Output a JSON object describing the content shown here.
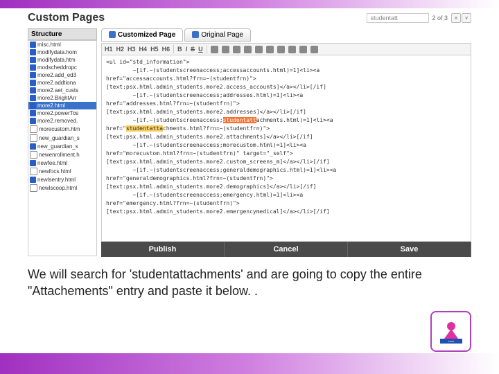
{
  "header": {
    "title": "Custom Pages",
    "search_value": "studentatt",
    "search_count": "2 of 3"
  },
  "sidebar": {
    "heading": "Structure",
    "items": [
      {
        "icon": "blue",
        "label": "misc.html"
      },
      {
        "icon": "blue",
        "label": "modifydata.hom"
      },
      {
        "icon": "blue",
        "label": "modifydata.htm"
      },
      {
        "icon": "blue",
        "label": "modscheddropc"
      },
      {
        "icon": "blue",
        "label": "more2.add_ed3"
      },
      {
        "icon": "blue",
        "label": "more2.addtiona"
      },
      {
        "icon": "blue",
        "label": "more2.aet_custs"
      },
      {
        "icon": "blue",
        "label": "more2.BrightArr"
      },
      {
        "icon": "blue",
        "label": "more2.html",
        "selected": true
      },
      {
        "icon": "blue",
        "label": "more2.powerTos"
      },
      {
        "icon": "blue",
        "label": "more2.removed."
      },
      {
        "icon": "doc",
        "label": "morecustom.htm"
      },
      {
        "icon": "doc",
        "label": "new_guardian_s"
      },
      {
        "icon": "blue",
        "label": "new_guardian_s"
      },
      {
        "icon": "doc",
        "label": "newenrollment.h"
      },
      {
        "icon": "blue",
        "label": "newfee.html"
      },
      {
        "icon": "doc",
        "label": "newfocs.html"
      },
      {
        "icon": "blue",
        "label": "newlsentry.html"
      },
      {
        "icon": "doc",
        "label": "newlscoop.html"
      }
    ]
  },
  "tabs": {
    "active": "Customized Page",
    "inactive": "Original Page"
  },
  "toolbar": {
    "headings": [
      "H1",
      "H2",
      "H3",
      "H4",
      "H5",
      "H6"
    ],
    "format": [
      "B",
      "I",
      "S",
      "U"
    ],
    "icons": [
      "list-icon",
      "link-icon",
      "image-icon",
      "code-icon",
      "table-icon",
      "undo-icon",
      "redo-icon",
      "help-icon",
      "save-icon",
      "toggle-icon"
    ]
  },
  "code": {
    "l1": "<ul id=\"std_information\">",
    "l2a": "~[if.~(studentscreenaccess;accessaccounts.html)=1]<li><a",
    "l2b": "href=\"accessaccounts.html?frn=~(studentfrn)\">",
    "l2c": "[text:psx.html.admin_students.more2.access_accounts]</a></li>[/if]",
    "l3a": "~[if.~(studentscreenaccess;addresses.html)=1]<li><a",
    "l3b": "href=\"addresses.html?frn=~(studentfrn)\">",
    "l3c": "[text:psx.html.admin_students.more2.addresses]</a></li>[/if]",
    "l4a": "~[if.~(studentscreenaccess;",
    "l4hl": "studentatt",
    "l4b": "achments.html)=1]<li><a",
    "l5a": "href=\"",
    "l5hl": "studentatta",
    "l5b": "chments.html?frn=~(studentfrn)\">",
    "l5c": "[text:psx.html.admin_students.more2.attachments]</a></li>[/if]",
    "l6a": "~[if.~(studentscreenaccess;morecustom.html)=1]<li><a",
    "l6b": "href=\"morecustom.html?frn=~(studentfrn)\" target=\"_self\">",
    "l6c": "[text:psx.html.admin_students.more2.custom_screens_m]</a></li>[/if]",
    "l7a": "~[if.~(studentscreenaccess;generaldemographics.html)=1]<li><a",
    "l7b": "href=\"generaldemographics.html?frn=~(studentfrn)\">",
    "l7c": "[text:psx.html.admin_students.more2.demographics]</a></li>[/if]",
    "l8a": "~[if.~(studentscreenaccess;emergency.html)=1]<li><a",
    "l8b": "href=\"emergency.html?frn=~(studentfrn)\">",
    "l8c": "[text:psx.html.admin_students.more2.emergencymedical]</a></li>[/if]"
  },
  "buttons": {
    "publish": "Publish",
    "cancel": "Cancel",
    "save": "Save"
  },
  "caption": "We will search for 'studentattachments' and are going to copy the entire \"Attachements\" entry and paste it below. ."
}
